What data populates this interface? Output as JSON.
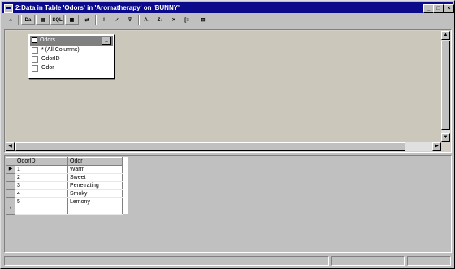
{
  "window": {
    "title": "2:Data in Table 'Odors' in 'Aromatherapy' on 'BUNNY'",
    "controls": {
      "minimize": "_",
      "maximize": "□",
      "close": "×"
    }
  },
  "toolbar": {
    "buttons": [
      {
        "name": "properties",
        "glyph": "⌂"
      },
      {
        "name": "diagram-pane",
        "glyph": "Da"
      },
      {
        "name": "grid-pane",
        "glyph": "▤"
      },
      {
        "name": "sql-pane",
        "glyph": "SQL"
      },
      {
        "name": "results-pane",
        "glyph": "▦"
      },
      {
        "name": "change-type",
        "glyph": "⇄"
      },
      {
        "name": "run",
        "glyph": "!"
      },
      {
        "name": "verify-sql",
        "glyph": "✓"
      },
      {
        "name": "remove-filter",
        "glyph": "⊽"
      },
      {
        "name": "sort-ascending",
        "glyph": "A↓"
      },
      {
        "name": "sort-descending",
        "glyph": "Z↓"
      },
      {
        "name": "remove-filter-2",
        "glyph": "✕"
      },
      {
        "name": "group-by",
        "glyph": "[≡"
      },
      {
        "name": "add-table",
        "glyph": "⊞"
      }
    ]
  },
  "diagram": {
    "table": {
      "name": "Odors",
      "columns": [
        "* (All Columns)",
        "OdorID",
        "Odor"
      ]
    }
  },
  "grid": {
    "headers": [
      "OdorID",
      "Odor"
    ],
    "rows": [
      {
        "id": "1",
        "odor": "Warm"
      },
      {
        "id": "2",
        "odor": "Sweet"
      },
      {
        "id": "3",
        "odor": "Penetrating"
      },
      {
        "id": "4",
        "odor": "Smoky"
      },
      {
        "id": "5",
        "odor": "Lemony"
      }
    ],
    "current_row_marker": "▶",
    "new_row_marker": "*"
  }
}
